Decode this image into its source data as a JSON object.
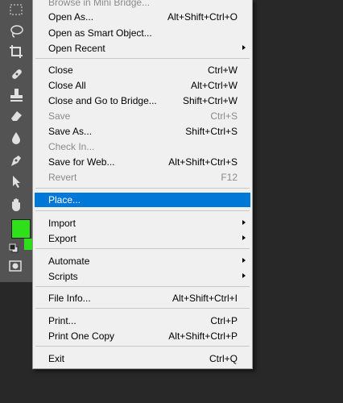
{
  "colors": {
    "menu_bg": "#f0f0f0",
    "highlight": "#0078d7",
    "disabled_text": "#8a8a8a",
    "toolbar_bg": "#535353",
    "foreground_color": "#2ee01a"
  },
  "toolbar": {
    "tools": [
      {
        "icon": "rectangular-marquee-icon"
      },
      {
        "icon": "lasso-icon"
      },
      {
        "icon": "crop-icon"
      },
      {
        "icon": "healing-brush-icon"
      },
      {
        "icon": "clone-stamp-icon"
      },
      {
        "icon": "eraser-icon"
      },
      {
        "icon": "blur-icon"
      },
      {
        "icon": "pen-icon"
      },
      {
        "icon": "path-selection-icon"
      },
      {
        "icon": "hand-icon"
      }
    ]
  },
  "menu": {
    "items": [
      {
        "label": "Browse in Mini Bridge...",
        "shortcut": "",
        "disabled": true
      },
      {
        "label": "Open As...",
        "shortcut": "Alt+Shift+Ctrl+O"
      },
      {
        "label": "Open as Smart Object...",
        "shortcut": ""
      },
      {
        "label": "Open Recent",
        "shortcut": "",
        "submenu": true
      },
      {
        "label": "Close",
        "shortcut": "Ctrl+W"
      },
      {
        "label": "Close All",
        "shortcut": "Alt+Ctrl+W"
      },
      {
        "label": "Close and Go to Bridge...",
        "shortcut": "Shift+Ctrl+W"
      },
      {
        "label": "Save",
        "shortcut": "Ctrl+S",
        "disabled": true
      },
      {
        "label": "Save As...",
        "shortcut": "Shift+Ctrl+S"
      },
      {
        "label": "Check In...",
        "shortcut": "",
        "disabled": true
      },
      {
        "label": "Save for Web...",
        "shortcut": "Alt+Shift+Ctrl+S"
      },
      {
        "label": "Revert",
        "shortcut": "F12",
        "disabled": true
      },
      {
        "label": "Place...",
        "shortcut": "",
        "highlighted": true
      },
      {
        "label": "Import",
        "shortcut": "",
        "submenu": true
      },
      {
        "label": "Export",
        "shortcut": "",
        "submenu": true
      },
      {
        "label": "Automate",
        "shortcut": "",
        "submenu": true
      },
      {
        "label": "Scripts",
        "shortcut": "",
        "submenu": true
      },
      {
        "label": "File Info...",
        "shortcut": "Alt+Shift+Ctrl+I"
      },
      {
        "label": "Print...",
        "shortcut": "Ctrl+P"
      },
      {
        "label": "Print One Copy",
        "shortcut": "Alt+Shift+Ctrl+P"
      },
      {
        "label": "Exit",
        "shortcut": "Ctrl+Q"
      }
    ]
  }
}
